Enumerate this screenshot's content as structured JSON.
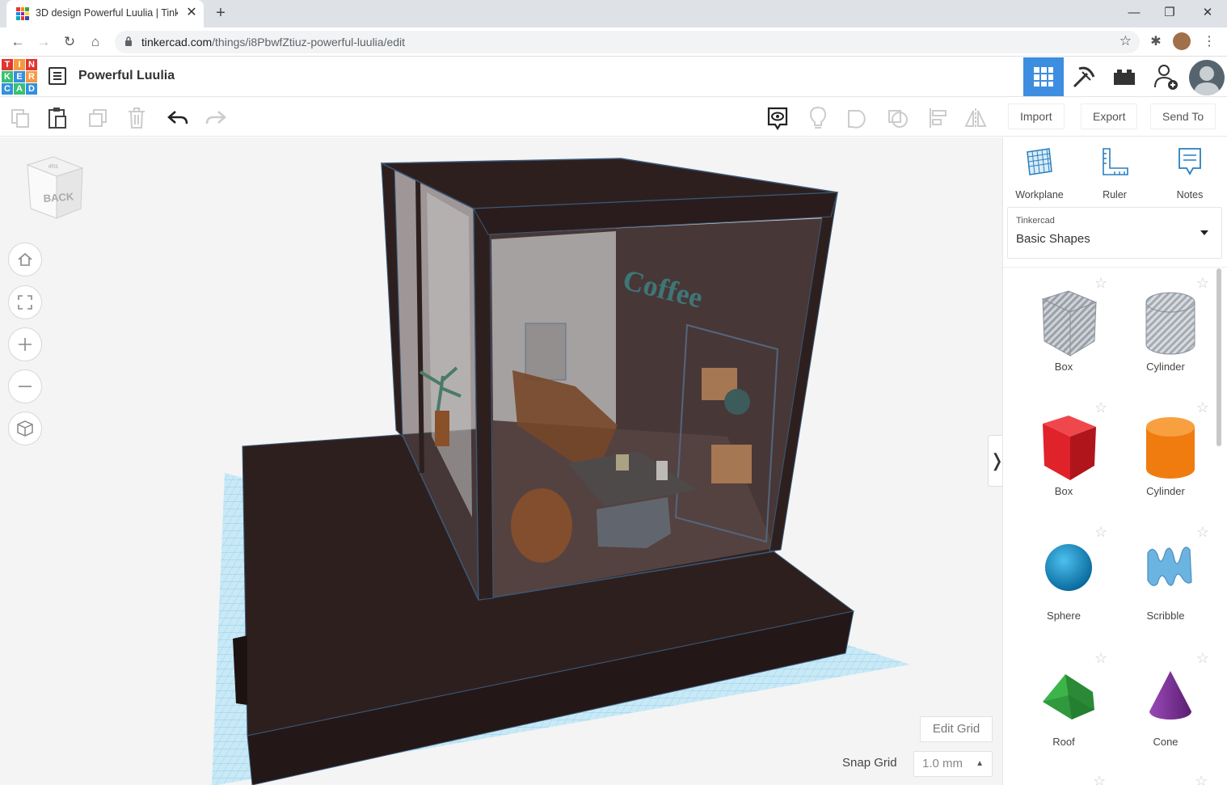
{
  "browser": {
    "tab_title": "3D design Powerful Luulia | Tinkercad",
    "url_host": "tinkercad.com",
    "url_path": "/things/i8PbwfZtiuz-powerful-luulia/edit"
  },
  "header": {
    "logo_letters": [
      "T",
      "I",
      "N",
      "K",
      "E",
      "R",
      "C",
      "A",
      "D"
    ],
    "doc_title": "Powerful Luulia"
  },
  "toolbar": {
    "import_label": "Import",
    "export_label": "Export",
    "send_to_label": "Send To"
  },
  "viewcube": {
    "face_label": "BACK",
    "top_label": "TOP"
  },
  "workspace": {
    "scene_text": "Coffee",
    "edit_grid_label": "Edit Grid",
    "snap_grid_label": "Snap Grid",
    "snap_grid_value": "1.0 mm"
  },
  "right_panel": {
    "tools": [
      {
        "label": "Workplane",
        "icon": "workplane-icon"
      },
      {
        "label": "Ruler",
        "icon": "ruler-icon"
      },
      {
        "label": "Notes",
        "icon": "notes-icon"
      }
    ],
    "library_source": "Tinkercad",
    "library_name": "Basic Shapes",
    "shapes": [
      {
        "name": "Box",
        "variant": "hole"
      },
      {
        "name": "Cylinder",
        "variant": "hole"
      },
      {
        "name": "Box",
        "color": "#e0222a"
      },
      {
        "name": "Cylinder",
        "color": "#f07c10"
      },
      {
        "name": "Sphere",
        "color": "#1a8fc8"
      },
      {
        "name": "Scribble",
        "color": "#6bb3e0"
      },
      {
        "name": "Roof",
        "color": "#2e9e3e"
      },
      {
        "name": "Cone",
        "color": "#7b2f96"
      }
    ]
  },
  "colors": {
    "accent": "#3d8ee0",
    "walls": "#2e1f1f",
    "grid": "#9fd6ee"
  }
}
